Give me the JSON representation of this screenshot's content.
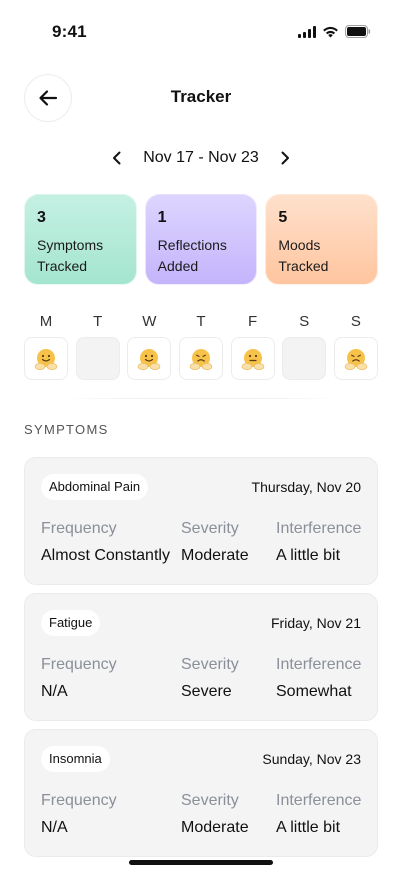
{
  "status_bar": {
    "time": "9:41"
  },
  "header": {
    "title": "Tracker"
  },
  "week": {
    "range": "Nov 17 - Nov 23"
  },
  "stats": [
    {
      "count": "3",
      "line1": "Symptoms",
      "line2": "Tracked"
    },
    {
      "count": "1",
      "line1": "Reflections",
      "line2": "Added"
    },
    {
      "count": "5",
      "line1": "Moods",
      "line2": "Tracked"
    }
  ],
  "days": [
    {
      "letter": "M",
      "mood": "smile"
    },
    {
      "letter": "T",
      "mood": "none"
    },
    {
      "letter": "W",
      "mood": "smile"
    },
    {
      "letter": "T",
      "mood": "sad"
    },
    {
      "letter": "F",
      "mood": "neutral"
    },
    {
      "letter": "S",
      "mood": "none"
    },
    {
      "letter": "S",
      "mood": "sad"
    }
  ],
  "symptoms_section": {
    "title": "SYMPTOMS"
  },
  "symptom_columns": {
    "frequency": "Frequency",
    "severity": "Severity",
    "interference": "Interference"
  },
  "symptoms": [
    {
      "name": "Abdominal Pain",
      "date": "Thursday, Nov 20",
      "frequency": "Almost Constantly",
      "severity": "Moderate",
      "interference": "A little bit"
    },
    {
      "name": "Fatigue",
      "date": "Friday, Nov 21",
      "frequency": "N/A",
      "severity": "Severe",
      "interference": "Somewhat"
    },
    {
      "name": "Insomnia",
      "date": "Sunday, Nov 23",
      "frequency": "N/A",
      "severity": "Moderate",
      "interference": "A little bit"
    }
  ],
  "colors": {
    "green": "#a4e5cf",
    "purple": "#c4b4fb",
    "orange": "#ffc59f",
    "muted": "#8a8f98"
  },
  "icons": [
    "signal-icon",
    "wifi-icon",
    "battery-icon",
    "back-arrow-icon",
    "chevron-left-icon",
    "chevron-right-icon",
    "mood-emoji-icon"
  ]
}
